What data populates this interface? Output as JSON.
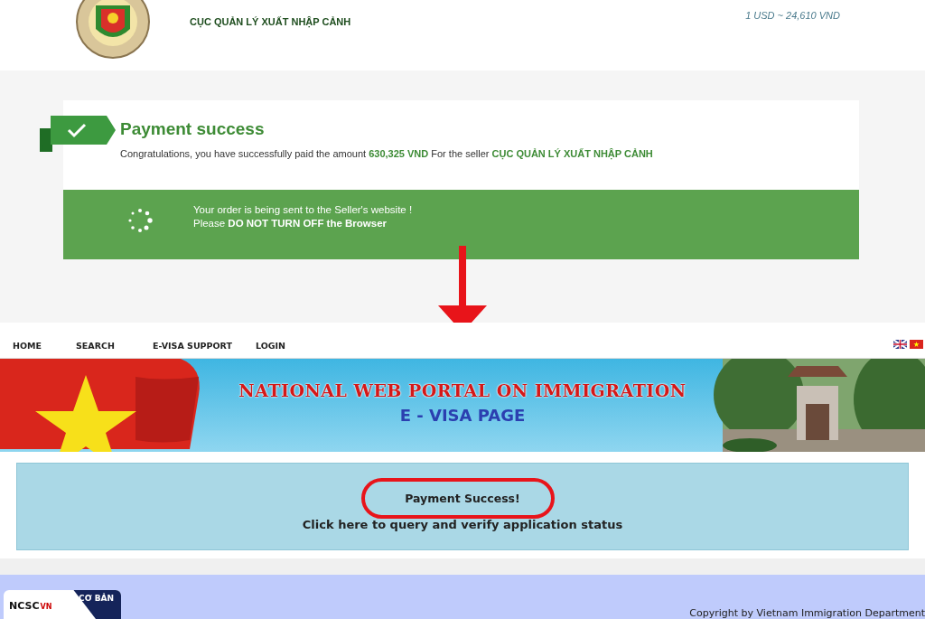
{
  "header": {
    "org_name": "CỤC QUẢN LÝ XUẤT NHẬP CẢNH",
    "exchange_rate": "1 USD ~ 24,610 VND"
  },
  "payment": {
    "title": "Payment success",
    "message": "Congratulations, you have successfully paid the amount **630,325 VND** For the seller **CỤC QUẢN LÝ XUẤT NHẬP CẢNH**",
    "notice_line_1": "Your order is being sent to the Seller's website !",
    "notice_line_2": "Please **DO NOT TURN OFF the Browser**"
  },
  "portal": {
    "nav": [
      {
        "label": "HOME"
      },
      {
        "label": "SEARCH"
      },
      {
        "label": "E-VISA SUPPORT"
      },
      {
        "label": "LOGIN"
      }
    ],
    "banner_title": "NATIONAL WEB PORTAL ON IMMIGRATION",
    "banner_subtitle": "E - VISA PAGE",
    "status_title": "Payment Success!",
    "status_link": "Click here to query and verify application status",
    "badge_name": "NCSC",
    "badge_country": "VN",
    "badge_level": "CƠ BẢN",
    "copyright": "Copyright by Vietnam Immigration Department"
  }
}
